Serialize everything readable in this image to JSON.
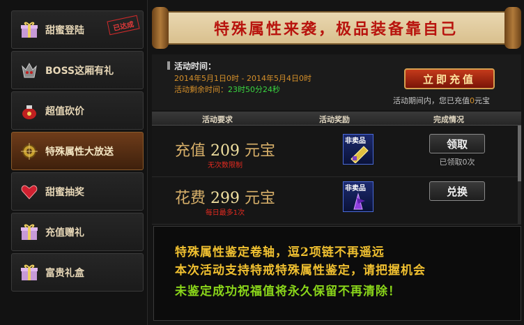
{
  "sidebar": {
    "items": [
      {
        "label": "甜蜜登陆",
        "icon": "gift-box-icon",
        "stamp": "已达成"
      },
      {
        "label": "BOSS这厢有礼",
        "icon": "boss-helmet-icon"
      },
      {
        "label": "超值砍价",
        "icon": "money-bag-icon"
      },
      {
        "label": "特殊属性大放送",
        "icon": "orb-icon"
      },
      {
        "label": "甜蜜抽奖",
        "icon": "heart-icon"
      },
      {
        "label": "充值赠礼",
        "icon": "gift-box-icon"
      },
      {
        "label": "富贵礼盒",
        "icon": "gift-box-icon"
      }
    ],
    "active_index": 3
  },
  "banner": {
    "title": "特殊属性来袭，极品装备靠自己"
  },
  "info": {
    "time_title": "活动时间：",
    "time_range": "2014年5月1日0时 - 2014年5月4日0时",
    "remaining_label": "活动剩余时间：",
    "remaining_value": "23时50分24秒",
    "recharge_button": "立即充值",
    "period_prefix": "活动期间内，您已充值",
    "period_amount": "0",
    "period_suffix": "元宝"
  },
  "table": {
    "headers": [
      "活动要求",
      "活动奖励",
      "完成情况"
    ],
    "rows": [
      {
        "req_prefix": "充值",
        "req_amount": "209",
        "req_unit": "元宝",
        "req_note": "无次数限制",
        "reward_tag": "非卖品",
        "reward_icon": "scroll-item-icon",
        "action": "领取",
        "status": "已领取0次"
      },
      {
        "req_prefix": "花费",
        "req_amount": "299",
        "req_unit": "元宝",
        "req_note": "每日最多1次",
        "reward_tag": "非卖品",
        "reward_icon": "purple-claw-item-icon",
        "action": "兑换",
        "status": ""
      }
    ]
  },
  "notice": {
    "line1": "特殊属性鉴定卷轴，逗2项链不再遥远",
    "line2": "本次活动支持特戒特殊属性鉴定，请把握机会",
    "line3": "未鉴定成功祝福值将永久保留不再清除！"
  },
  "colors": {
    "accent": "#b8140e",
    "highlight": "#f0c030",
    "green": "#8ad61a"
  }
}
